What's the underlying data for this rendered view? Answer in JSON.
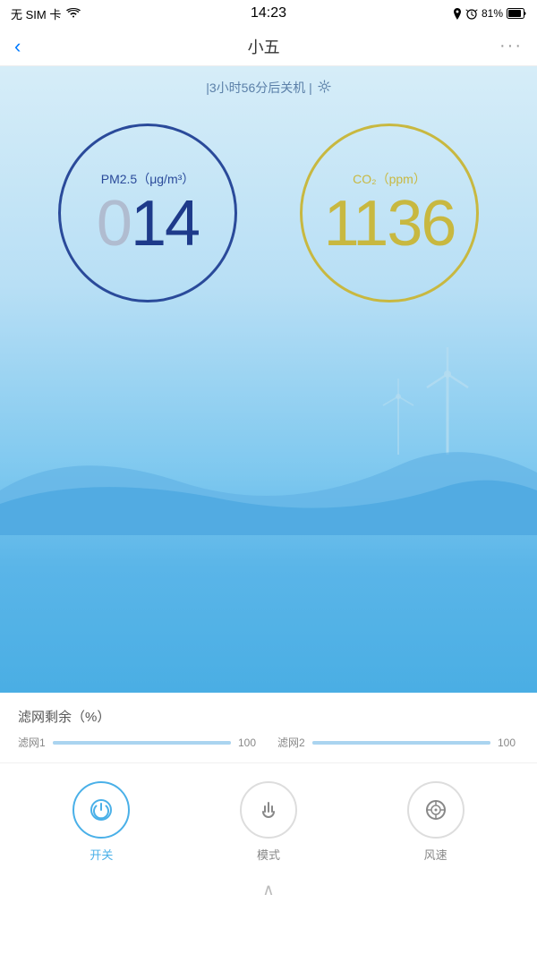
{
  "statusBar": {
    "carrier": "无 SIM 卡",
    "wifi": "WiFi",
    "time": "14:23",
    "batteryPercent": "81%",
    "batteryIcon": "🔋"
  },
  "navBar": {
    "back": "‹",
    "title": "小五",
    "more": "···"
  },
  "timer": {
    "text": "|3小时56分后关机 |",
    "icon": "☼"
  },
  "gauges": {
    "pm25": {
      "label": "PM2.5（μg/m³）",
      "valueLeading": "0",
      "valueMain": "14",
      "color": "#2a4a9a"
    },
    "co2": {
      "label": "CO₂（ppm）",
      "value": "1136",
      "color": "#c8b840"
    }
  },
  "filter": {
    "title": "滤网剩余（%）",
    "filter1": {
      "label": "滤网1",
      "value": "100",
      "percent": 100
    },
    "filter2": {
      "label": "滤网2",
      "value": "100",
      "percent": 100
    }
  },
  "controls": {
    "power": {
      "label": "开关",
      "active": true
    },
    "mode": {
      "label": "模式",
      "active": false
    },
    "wind": {
      "label": "风速",
      "active": false
    }
  },
  "bottomHandle": "∧"
}
